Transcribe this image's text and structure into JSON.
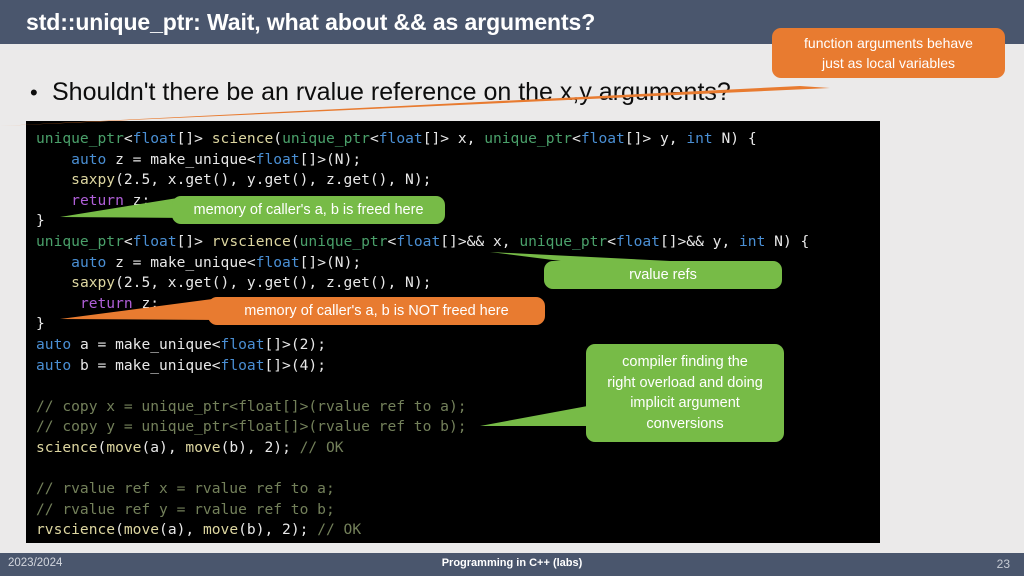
{
  "slide": {
    "title": "std::unique_ptr: Wait, what about && as arguments?",
    "bullet": "Shouldn't there be an rvalue reference on the x,y arguments?",
    "bullet_marker": "•"
  },
  "colors": {
    "title_bar": "#4a566d",
    "background": "#ebeaea",
    "code_background": "#000000",
    "callout_green": "#77bb47",
    "callout_orange": "#e87b30",
    "footer_bar": "#4a566d",
    "syntax_type": "#4aa06a",
    "syntax_keyword": "#4a8fd4",
    "syntax_return": "#b05fd8",
    "syntax_comment": "#73805a",
    "syntax_var": "#ddd6a0",
    "syntax_plain": "#e8e8e8"
  },
  "code": {
    "language": "cpp",
    "lines": [
      "unique_ptr<float[]> science(unique_ptr<float[]> x, unique_ptr<float[]> y, int N) {",
      "    auto z = make_unique<float[]>(N);",
      "    saxpy(2.5, x.get(), y.get(), z.get(), N);",
      "    return z;",
      "}",
      "unique_ptr<float[]> rvscience(unique_ptr<float[]>&& x, unique_ptr<float[]>&& y, int N) {",
      "    auto z = make_unique<float[]>(N);",
      "    saxpy(2.5, x.get(), y.get(), z.get(), N);",
      "     return z;",
      "}",
      "auto a = make_unique<float[]>(2);",
      "auto b = make_unique<float[]>(4);",
      "",
      "// copy x = unique_ptr<float[]>(rvalue ref to a);",
      "// copy y = unique_ptr<float[]>(rvalue ref to b);",
      "science(move(a), move(b), 2); // OK",
      "",
      "// rvalue ref x = rvalue ref to a;",
      "// rvalue ref y = rvalue ref to b;",
      "rvscience(move(a), move(b), 2); // OK"
    ]
  },
  "callouts": [
    {
      "id": "function-arguments",
      "color": "orange",
      "lines": [
        "function arguments behave",
        "just as local variables"
      ]
    },
    {
      "id": "memory-freed",
      "color": "green",
      "lines": [
        "memory of caller's a, b is freed here"
      ]
    },
    {
      "id": "rvalue-refs",
      "color": "green",
      "lines": [
        "rvalue refs"
      ]
    },
    {
      "id": "memory-not-freed",
      "color": "orange",
      "lines": [
        "memory of caller's a, b is NOT freed here"
      ]
    },
    {
      "id": "compiler-overload",
      "color": "green",
      "lines": [
        "compiler finding the",
        "right overload and doing",
        "implicit argument",
        "conversions"
      ]
    }
  ],
  "footer": {
    "left": "2023/2024",
    "center": "Programming in C++ (labs)",
    "right": "23"
  }
}
